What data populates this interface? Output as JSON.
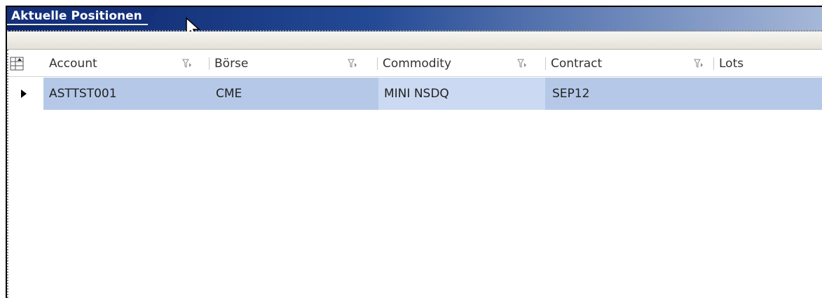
{
  "window": {
    "title": "Aktuelle Positionen"
  },
  "grid": {
    "columns": [
      {
        "label": "Account"
      },
      {
        "label": "Börse"
      },
      {
        "label": "Commodity"
      },
      {
        "label": "Contract"
      },
      {
        "label": "Lots"
      }
    ],
    "rows": [
      {
        "account": "ASTTST001",
        "boerse": "CME",
        "commodity": "MINI NSDQ",
        "contract": "SEP12",
        "lots": ""
      }
    ]
  },
  "colors": {
    "title_bar": "#14307a",
    "selected_row": "#b5c8e8",
    "active_cell": "#cbdaf2"
  }
}
